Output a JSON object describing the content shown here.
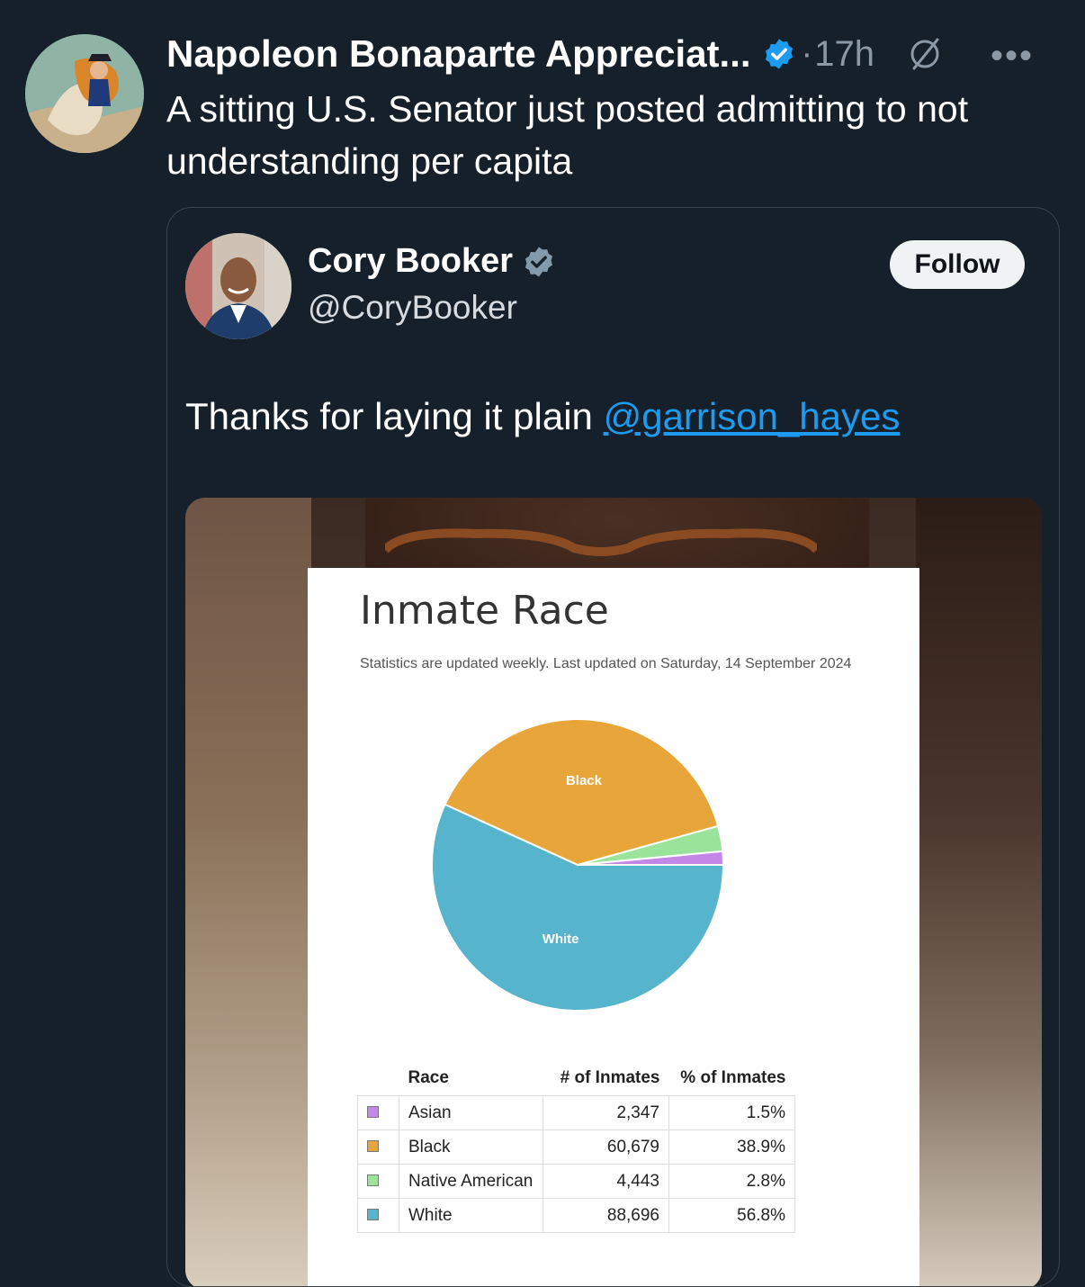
{
  "tweet": {
    "author_name": "Napoleon Bonaparte Appreciat...",
    "time": "17h",
    "separator": "·",
    "text": "A sitting U.S. Senator just posted admitting to not understanding per capita",
    "icons": [
      "verified-badge-icon",
      "grok-icon",
      "more-icon"
    ]
  },
  "quote": {
    "name": "Cory Booker",
    "handle": "@CoryBooker",
    "follow_label": "Follow",
    "text_before": "Thanks for laying it plain ",
    "mention": "@garrison_hayes"
  },
  "document": {
    "title": "Inmate Race",
    "subtitle": "Statistics are updated weekly. Last updated on Saturday, 14 September 2024",
    "table": {
      "headers": [
        "Race",
        "# of Inmates",
        "% of Inmates"
      ],
      "rows": [
        {
          "race": "Asian",
          "count": "2,347",
          "percent": "1.5%",
          "color": "#c387e8"
        },
        {
          "race": "Black",
          "count": "60,679",
          "percent": "38.9%",
          "color": "#e8a53a"
        },
        {
          "race": "Native American",
          "count": "4,443",
          "percent": "2.8%",
          "color": "#9ae39a"
        },
        {
          "race": "White",
          "count": "88,696",
          "percent": "56.8%",
          "color": "#56b4cc"
        }
      ]
    }
  },
  "chart_data": {
    "type": "pie",
    "categories": [
      "Asian",
      "Black",
      "Native American",
      "White"
    ],
    "values": [
      1.5,
      38.9,
      2.8,
      56.8
    ],
    "colors": [
      "#c387e8",
      "#e8a53a",
      "#9ae39a",
      "#56b4cc"
    ],
    "slice_labels": [
      "",
      "Black",
      "",
      "White"
    ]
  },
  "colors": {
    "background": "#15202b",
    "link": "#1d9bf0",
    "muted": "#8b98a5"
  }
}
